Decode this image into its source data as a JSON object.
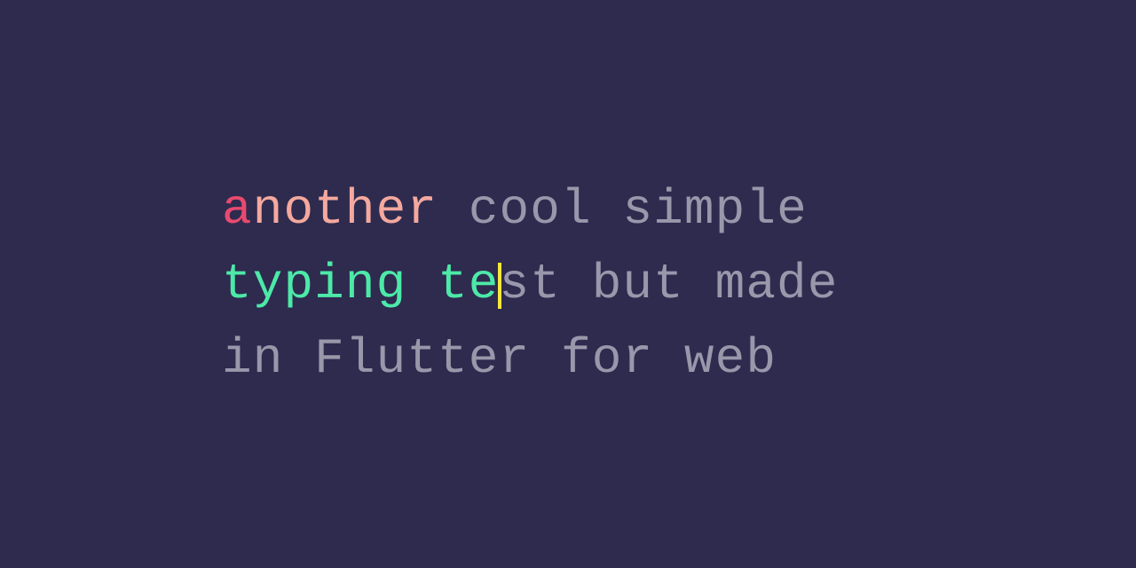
{
  "typing_test": {
    "word1_char1": "a",
    "word1_rest": "nother",
    "space1": " ",
    "pending1": "cool simple ",
    "word2_correct": "typing te",
    "pending2": "st but made in Flutter for web"
  },
  "colors": {
    "background": "#2e2b4f",
    "error": "#e84a6f",
    "partial": "#f5a89e",
    "correct": "#4de9a8",
    "pending": "#9a97ab",
    "cursor": "#f5e83b"
  }
}
